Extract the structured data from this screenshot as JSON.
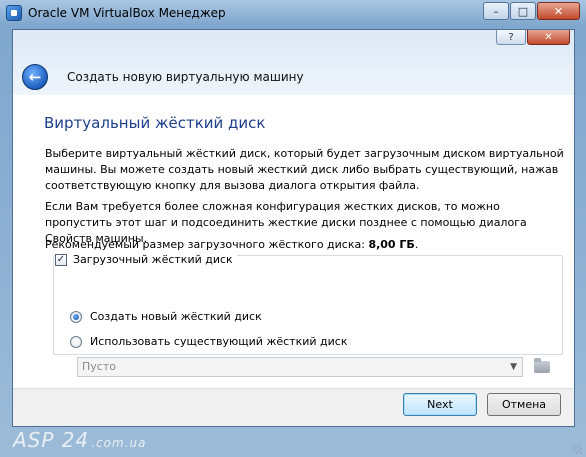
{
  "window": {
    "title": "Oracle VM VirtualBox Менеджер",
    "minimize": "–",
    "maximize": "□",
    "close": "✕"
  },
  "wizard": {
    "help": "?",
    "close": "✕",
    "back": "←",
    "caption": "Создать новую виртуальную машину",
    "page_title": "Виртуальный жёсткий диск",
    "para1": "Выберите виртуальный жёсткий диск, который будет загрузочным диском виртуальной машины. Вы можете создать новый жесткий диск либо выбрать существующий, нажав соответствующую кнопку для вызова диалога открытия файла.",
    "para2": "Если Вам требуется более сложная конфигурация жестких дисков, то можно пропустить этот шаг и подсоединить жесткие диски позднее с помощью диалога Свойств машины.",
    "recommended_prefix": "Рекомендуемый размер загрузочного жёсткого диска: ",
    "recommended_value": "8,00 ГБ",
    "recommended_suffix": ".",
    "boot_disk_label": "Загрузочный жёсткий диск",
    "boot_disk_checked": "✓",
    "option_create": "Создать новый жёсткий диск",
    "option_existing": "Использовать существующий жёсткий диск",
    "combo_value": "Пусто",
    "combo_arrow": "▼",
    "next_label": "Next",
    "cancel_label": "Отмена"
  },
  "watermark": {
    "main": "ASP 24",
    "domain": ".com.ua"
  }
}
